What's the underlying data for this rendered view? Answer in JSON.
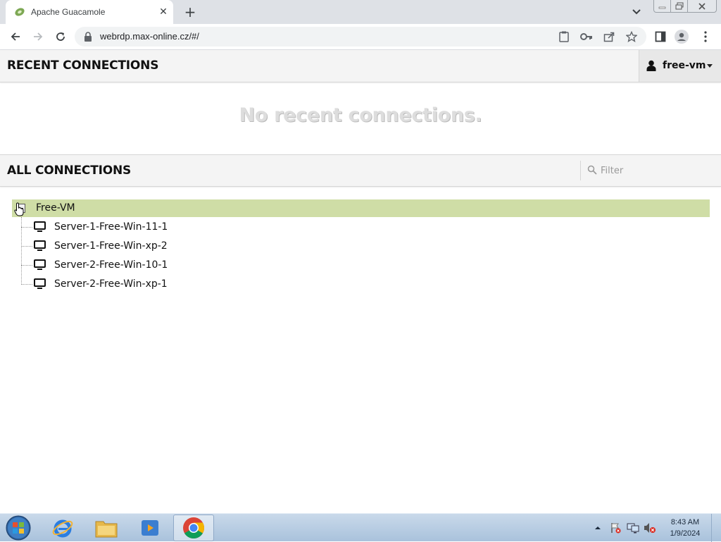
{
  "browser": {
    "tab": {
      "title": "Apache Guacamole",
      "favicon": "guacamole-leaf-icon"
    },
    "new_tab_icon": "plus-icon",
    "address_bar": {
      "url": "webrdp.max-online.cz/#/"
    },
    "icons": [
      "back-icon",
      "forward-icon",
      "reload-icon",
      "lock-icon",
      "clipboard-icon",
      "key-icon",
      "share-icon",
      "star-icon",
      "side-panel-icon",
      "profile-icon",
      "more-vert-icon"
    ]
  },
  "recent": {
    "title": "RECENT CONNECTIONS",
    "empty_message": "No recent connections."
  },
  "user_menu": {
    "username": "free-vm"
  },
  "all": {
    "title": "ALL CONNECTIONS",
    "filter_placeholder": "Filter"
  },
  "tree": {
    "group": {
      "name": "Free-VM",
      "expanded": true
    },
    "connections": [
      {
        "name": "Server-1-Free-Win-11-1"
      },
      {
        "name": "Server-1-Free-Win-xp-2"
      },
      {
        "name": "Server-2-Free-Win-10-1"
      },
      {
        "name": "Server-2-Free-Win-xp-1"
      }
    ]
  },
  "taskbar": {
    "apps": [
      "internet-explorer-icon",
      "file-explorer-icon",
      "media-player-icon",
      "chrome-icon"
    ],
    "active_app": "chrome-icon",
    "clock": {
      "time": "8:43 AM",
      "date": "1/9/2024"
    }
  },
  "colors": {
    "selected_group": "#cfdda6",
    "header_bg": "#f4f4f4",
    "tab_strip": "#dee1e6"
  }
}
